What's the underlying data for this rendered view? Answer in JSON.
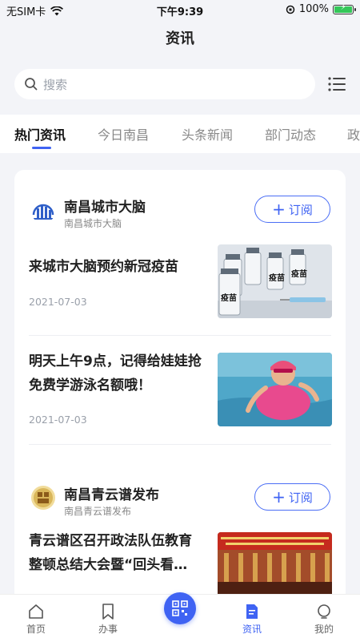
{
  "status_bar": {
    "carrier": "无SIM卡",
    "time": "下午9:39",
    "battery": "100%"
  },
  "header": {
    "title": "资讯"
  },
  "search": {
    "placeholder": "搜索"
  },
  "tabs": [
    {
      "label": "热门资讯",
      "active": true
    },
    {
      "label": "今日南昌"
    },
    {
      "label": "头条新闻"
    },
    {
      "label": "部门动态"
    },
    {
      "label": "政"
    }
  ],
  "publishers": [
    {
      "name": "南昌城市大脑",
      "subtitle": "南昌城市大脑",
      "subscribe_label": "订阅",
      "articles": [
        {
          "title": "来城市大脑预约新冠疫苗",
          "date": "2021-07-03",
          "thumb_label": "疫苗"
        },
        {
          "title": "明天上午9点，记得给娃娃抢免费学游泳名额哦！",
          "date": "2021-07-03"
        }
      ]
    },
    {
      "name": "南昌青云谱发布",
      "subtitle": "南昌青云谱发布",
      "subscribe_label": "订阅",
      "articles": [
        {
          "title": "青云谱区召开政法队伍教育整顿总结大会暨“回头看…"
        }
      ]
    }
  ],
  "bottom_nav": [
    {
      "label": "首页",
      "icon": "home-icon"
    },
    {
      "label": "办事",
      "icon": "bookmark-icon"
    },
    {
      "label": "",
      "icon": "qr-code-icon"
    },
    {
      "label": "资讯",
      "icon": "news-icon",
      "active": true
    },
    {
      "label": "我的",
      "icon": "profile-icon"
    }
  ],
  "colors": {
    "accent": "#3f63f3",
    "background": "#f3f4f8"
  }
}
